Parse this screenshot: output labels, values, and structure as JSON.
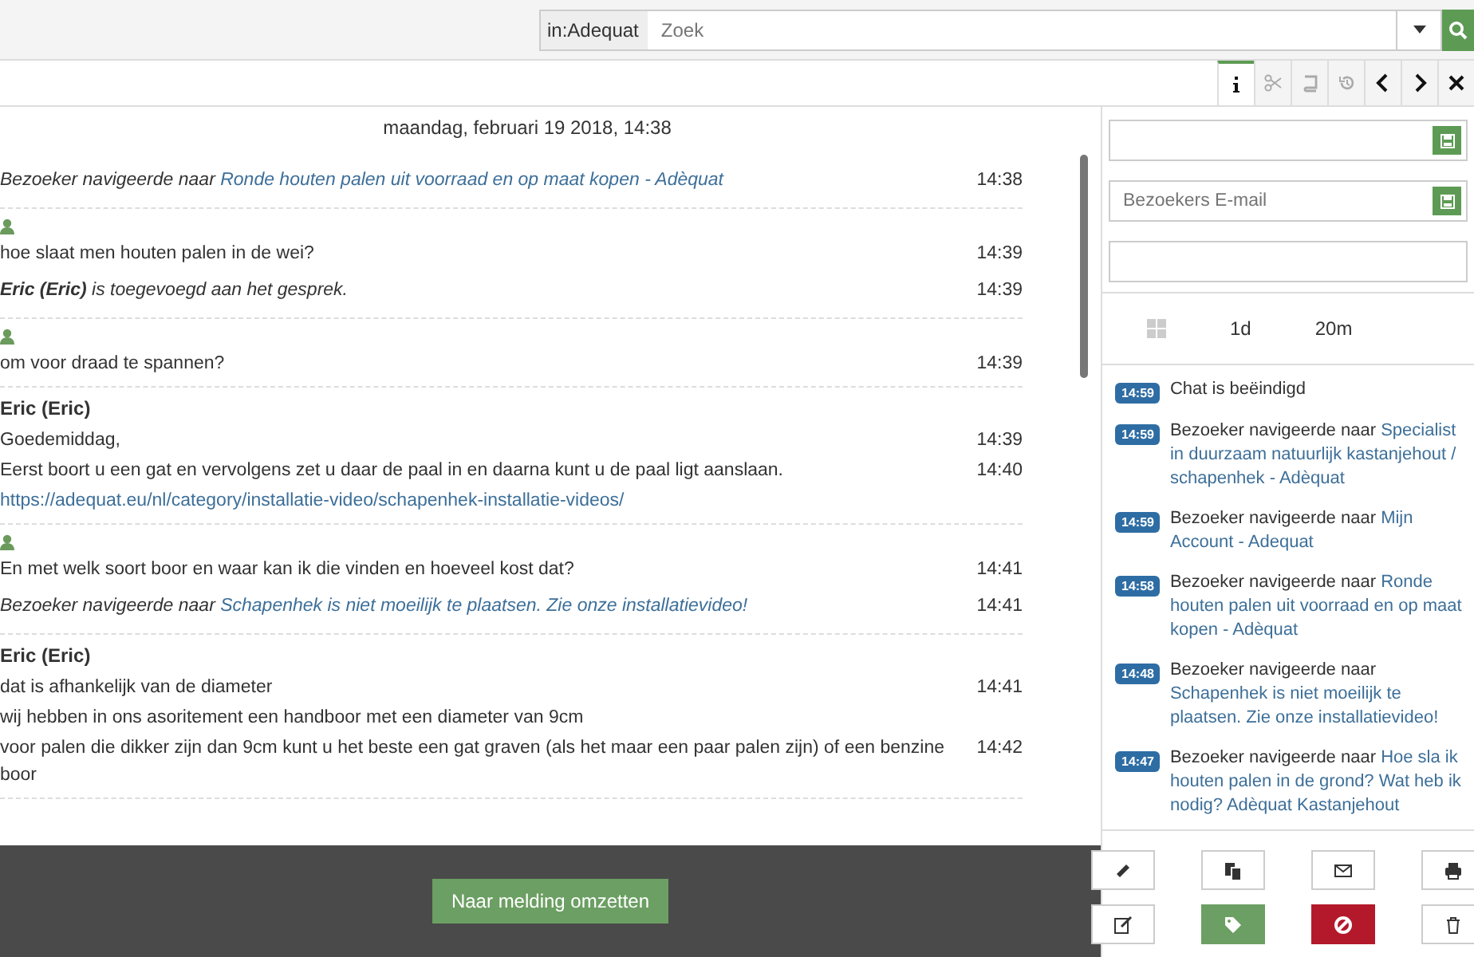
{
  "search": {
    "scope": "in:Adequat",
    "placeholder": "Zoek"
  },
  "toolbar": [
    {
      "selected": true,
      "disabled": false
    },
    {
      "selected": false,
      "disabled": true
    },
    {
      "selected": false,
      "disabled": true
    },
    {
      "selected": false,
      "disabled": true
    },
    {
      "selected": false,
      "disabled": false
    },
    {
      "selected": false,
      "disabled": false
    },
    {
      "selected": false,
      "disabled": false
    }
  ],
  "chat": {
    "date": "maandag, februari 19 2018, 14:38",
    "groups": [
      {
        "kind": "event",
        "lines": [
          {
            "kind": "navigation",
            "text": "Bezoeker navigeerde naar",
            "link": "Ronde houten palen uit voorraad en op maat kopen - Adèquat",
            "time": "14:38"
          }
        ]
      },
      {
        "kind": "visitor",
        "lines": [
          {
            "kind": "text",
            "text": "hoe slaat men houten palen in de wei?",
            "time": "14:39"
          },
          {
            "kind": "join",
            "text": "**Eric (Eric)** is toegevoegd aan het gesprek.",
            "time": "14:39"
          }
        ]
      },
      {
        "kind": "visitor",
        "lines": [
          {
            "kind": "text",
            "text": "om voor draad te spannen?",
            "time": "14:39"
          }
        ]
      },
      {
        "kind": "agent",
        "author": "Eric (Eric)",
        "lines": [
          {
            "kind": "text",
            "text": "Goedemiddag,",
            "time": "14:39"
          },
          {
            "kind": "text",
            "text": "Eerst boort u een gat en vervolgens zet u daar de paal in en daarna kunt u de paal ligt aanslaan.",
            "time": "14:40"
          },
          {
            "kind": "url",
            "text": "https://adequat.eu/nl/category/installatie-video/schapenhek-installatie-videos/"
          }
        ]
      },
      {
        "kind": "visitor",
        "lines": [
          {
            "kind": "text",
            "text": "En met welk soort boor en waar kan ik die vinden en hoeveel kost dat?",
            "time": "14:41"
          },
          {
            "kind": "navigation",
            "text": "Bezoeker navigeerde naar",
            "link": "Schapenhek is niet moeilijk te plaatsen. Zie onze installatievideo!",
            "time": "14:41"
          }
        ]
      },
      {
        "kind": "agent",
        "author": "Eric (Eric)",
        "lines": [
          {
            "kind": "text",
            "text": "dat is afhankelijk van de diameter",
            "time": "14:41"
          },
          {
            "kind": "text",
            "text": "wij hebben in ons asoritement een handboor met een diameter van 9cm"
          },
          {
            "kind": "text",
            "text": "voor palen die dikker zijn dan 9cm kunt u het beste een gat graven (als het maar een paar palen zijn) of een benzine boor",
            "time": "14:42"
          }
        ]
      }
    ]
  },
  "convert_button": "Naar melding omzetten",
  "fields": [
    {
      "save": true
    },
    {
      "placeholder": "Bezoekers E-mail",
      "save": true
    },
    {
      "save": false
    }
  ],
  "stats": [
    "1d",
    "20m"
  ],
  "timeline": [
    {
      "time": "14:59",
      "text": "Chat is beëindigd"
    },
    {
      "time": "14:59",
      "text": "Bezoeker navigeerde naar",
      "link": "Specialist in duurzaam natuurlijk kastanjehout / schapenhek - Adèquat"
    },
    {
      "time": "14:59",
      "text": "Bezoeker navigeerde naar",
      "link": "Mijn Account - Adequat"
    },
    {
      "time": "14:58",
      "text": "Bezoeker navigeerde naar",
      "link": "Ronde houten palen uit voorraad en op maat kopen - Adèquat"
    },
    {
      "time": "14:48",
      "text": "Bezoeker navigeerde naar",
      "link": "Schapenhek is niet moeilijk te plaatsen. Zie onze installatievideo!"
    },
    {
      "time": "14:47",
      "text": "Bezoeker navigeerde naar",
      "link": "Hoe sla ik houten palen in de grond? Wat heb ik nodig? Adèquat Kastanjehout"
    }
  ],
  "actions": [
    {
      "kind": "plain"
    },
    {
      "kind": "plain"
    },
    {
      "kind": "plain"
    },
    {
      "kind": "plain"
    },
    {
      "kind": "plain"
    },
    {
      "kind": "success"
    },
    {
      "kind": "danger"
    },
    {
      "kind": "plain"
    }
  ]
}
